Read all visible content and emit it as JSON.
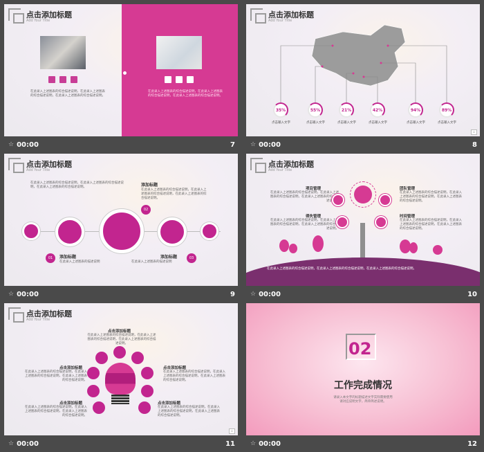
{
  "common": {
    "title": "点击添加标题",
    "subtitle": "Add Your Title",
    "time": "00:00",
    "body_text": "在此录入上述图表的综合描述说明，在此录入上述图表的综合描述说明，在此录入上述图表的综合描述说明。",
    "short_text": "在此录入上述图表的描述说明",
    "input_text": "点击输入文字",
    "add_title": "添加标题",
    "click_add_title": "点击添加标题"
  },
  "slides": [
    {
      "num": "7"
    },
    {
      "num": "8",
      "percents": [
        "35%",
        "55%",
        "21%",
        "42%",
        "94%",
        "89%"
      ]
    },
    {
      "num": "9",
      "badges": [
        "02",
        "01",
        "03"
      ]
    },
    {
      "num": "10",
      "labels": [
        "项目管理",
        "团队管理",
        "得失管理",
        "时间管理"
      ]
    },
    {
      "num": "11"
    },
    {
      "num": "12",
      "section_number": "02",
      "section_title": "工作完成情况",
      "desc": "请录入本文字的标题描述文字实际需要使用\n请对应说明文字，简单简述说明。"
    }
  ],
  "colors": {
    "accent": "#d63a93",
    "magenta": "#c2258f",
    "purple": "#7a2f6e"
  }
}
